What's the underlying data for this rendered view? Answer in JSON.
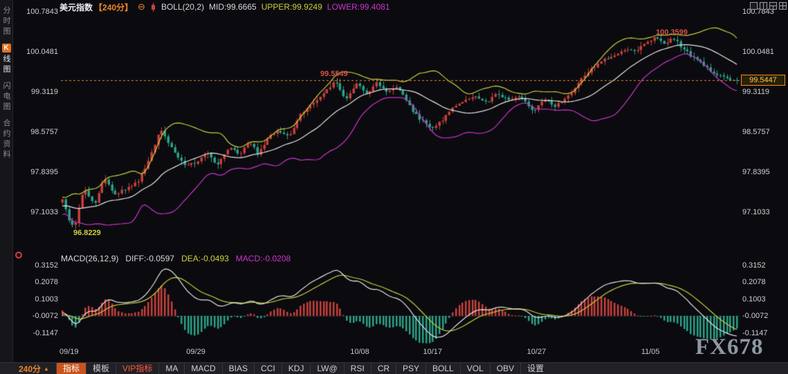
{
  "colors": {
    "up": "#c8403c",
    "down": "#2ba188",
    "boll_upper": "#cfcf3e",
    "boll_mid": "#e6e6e6",
    "boll_lower": "#cc35cc",
    "accent_orange": "#ef8428",
    "annotation_red": "#d5524a",
    "background": "#0b0b0f"
  },
  "sidebar": {
    "items": [
      {
        "id": "time-chart",
        "label": "分时图"
      },
      {
        "id": "kline-chart",
        "label": "K线图",
        "badge": "K",
        "rest": "线图"
      },
      {
        "id": "lightning-chart",
        "label": "闪电图"
      },
      {
        "id": "contract-info",
        "label": "合约资料"
      }
    ]
  },
  "header": {
    "symbol": "美元指数",
    "period": "【240分】",
    "minus_icon": "⊖",
    "boll_label": "BOLL(20,2)",
    "mid": "MID:99.6665",
    "upper": "UPPER:99.9249",
    "lower": "LOWER:99.4081"
  },
  "price_axis": {
    "labels": [
      "100.7843",
      "100.0481",
      "99.3119",
      "98.5757",
      "97.8395",
      "97.1033"
    ]
  },
  "macd_axis": {
    "labels": [
      "0.3152",
      "0.2078",
      "0.1003",
      "-0.0072",
      "-0.1147"
    ]
  },
  "annotations": {
    "peak_mid": "99.5549",
    "peak_high": "100.3599",
    "low": "96.8229",
    "last_price": "99.5447"
  },
  "macd_header": {
    "title": "MACD(26,12,9)",
    "diff": "DIFF:-0.0597",
    "dea": "DEA:-0.0493",
    "macd": "MACD:-0.0208"
  },
  "toolbar": {
    "period": "240分",
    "arrow": "▲",
    "tabs": [
      {
        "id": "indicator",
        "label": "指标",
        "style": "active"
      },
      {
        "id": "template",
        "label": "模板"
      },
      {
        "id": "vip-indicator",
        "label": "VIP指标",
        "style": "vip"
      },
      {
        "id": "ma",
        "label": "MA"
      },
      {
        "id": "macd",
        "label": "MACD"
      },
      {
        "id": "bias",
        "label": "BIAS"
      },
      {
        "id": "cci",
        "label": "CCI"
      },
      {
        "id": "kdj",
        "label": "KDJ"
      },
      {
        "id": "lwr",
        "label": "LW@"
      },
      {
        "id": "rsi",
        "label": "RSI"
      },
      {
        "id": "cr",
        "label": "CR"
      },
      {
        "id": "psy",
        "label": "PSY"
      },
      {
        "id": "boll",
        "label": "BOLL"
      },
      {
        "id": "vol",
        "label": "VOL"
      },
      {
        "id": "obv",
        "label": "OBV"
      },
      {
        "id": "settings",
        "label": "设置"
      }
    ]
  },
  "watermark": "FX678",
  "chart_data": {
    "type": "candlestick",
    "instrument": "美元指数",
    "period": "240分",
    "boll": {
      "period": 20,
      "width": 2,
      "mid": 99.6665,
      "upper": 99.9249,
      "lower": 99.4081
    },
    "macd": {
      "fast": 12,
      "slow": 26,
      "signal": 9,
      "diff": -0.0597,
      "dea": -0.0493,
      "macd": -0.0208
    },
    "last_price": 99.5447,
    "key_points": {
      "low": 96.8229,
      "peak_mid": 99.5549,
      "peak_high": 100.3599
    },
    "y_axis_price": [
      100.7843,
      100.0481,
      99.3119,
      98.5757,
      97.8395,
      97.1033
    ],
    "y_axis_macd": [
      0.3152,
      0.2078,
      0.1003,
      -0.0072,
      -0.1147
    ],
    "x_dates": [
      "09/19",
      "09/29",
      "10/08",
      "10/17",
      "10/27",
      "11/05"
    ],
    "x_date_fracs": [
      0.01,
      0.198,
      0.441,
      0.549,
      0.703,
      0.872
    ],
    "price_waypoints": [
      [
        0.0,
        97.35
      ],
      [
        0.01,
        96.95
      ],
      [
        0.018,
        96.87
      ],
      [
        0.032,
        97.55
      ],
      [
        0.048,
        97.28
      ],
      [
        0.062,
        97.75
      ],
      [
        0.078,
        97.45
      ],
      [
        0.095,
        97.55
      ],
      [
        0.112,
        97.68
      ],
      [
        0.128,
        98.05
      ],
      [
        0.145,
        98.65
      ],
      [
        0.162,
        98.3
      ],
      [
        0.18,
        97.98
      ],
      [
        0.2,
        98.02
      ],
      [
        0.215,
        98.22
      ],
      [
        0.228,
        97.98
      ],
      [
        0.248,
        98.32
      ],
      [
        0.262,
        98.18
      ],
      [
        0.278,
        98.42
      ],
      [
        0.29,
        98.18
      ],
      [
        0.305,
        98.48
      ],
      [
        0.32,
        98.62
      ],
      [
        0.335,
        98.5
      ],
      [
        0.355,
        98.95
      ],
      [
        0.375,
        99.15
      ],
      [
        0.392,
        99.35
      ],
      [
        0.405,
        99.55
      ],
      [
        0.42,
        99.18
      ],
      [
        0.436,
        99.46
      ],
      [
        0.452,
        99.3
      ],
      [
        0.466,
        99.5
      ],
      [
        0.482,
        99.32
      ],
      [
        0.496,
        99.44
      ],
      [
        0.512,
        99.1
      ],
      [
        0.528,
        98.85
      ],
      [
        0.545,
        98.66
      ],
      [
        0.562,
        98.78
      ],
      [
        0.578,
        99.02
      ],
      [
        0.595,
        99.15
      ],
      [
        0.612,
        99.24
      ],
      [
        0.628,
        99.12
      ],
      [
        0.645,
        99.3
      ],
      [
        0.66,
        99.18
      ],
      [
        0.676,
        99.26
      ],
      [
        0.69,
        99.08
      ],
      [
        0.7,
        98.98
      ],
      [
        0.714,
        99.2
      ],
      [
        0.728,
        99.06
      ],
      [
        0.742,
        99.16
      ],
      [
        0.758,
        99.35
      ],
      [
        0.772,
        99.62
      ],
      [
        0.788,
        99.78
      ],
      [
        0.804,
        99.92
      ],
      [
        0.82,
        100.02
      ],
      [
        0.836,
        100.12
      ],
      [
        0.85,
        100.06
      ],
      [
        0.865,
        100.22
      ],
      [
        0.878,
        100.33
      ],
      [
        0.892,
        100.22
      ],
      [
        0.906,
        100.31
      ],
      [
        0.92,
        100.12
      ],
      [
        0.936,
        99.95
      ],
      [
        0.952,
        99.8
      ],
      [
        0.968,
        99.66
      ],
      [
        0.984,
        99.58
      ],
      [
        1.0,
        99.545
      ]
    ]
  }
}
